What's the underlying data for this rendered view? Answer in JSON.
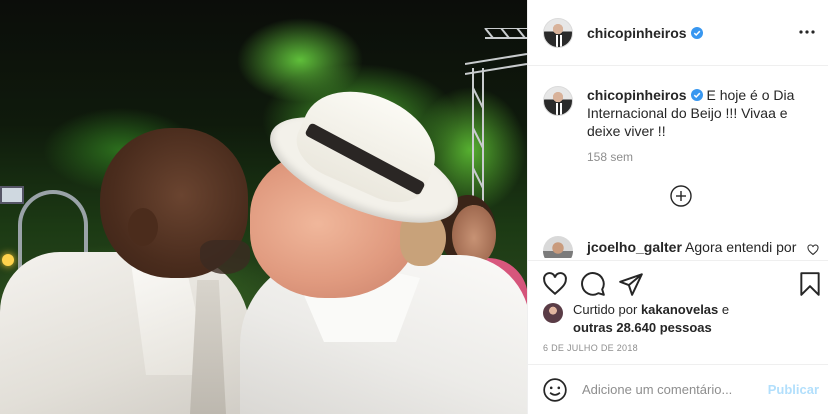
{
  "post": {
    "username": "chicopinheiros",
    "caption": "E hoje é o Dia Internacional do Beijo !!! Vivaa e deixe viver !!",
    "time_ago": "158 sem",
    "comment_preview": {
      "username": "jcoelho_galter",
      "text": "Agora entendi por"
    },
    "likes": {
      "prefix": "Curtido por",
      "user": "kakanovelas",
      "connector": "e",
      "others": "outras 28.640 pessoas"
    },
    "date": "6 DE JULHO DE 2018"
  },
  "comment_box": {
    "placeholder": "Adicione um comentário...",
    "post_label": "Publicar"
  },
  "icons": {
    "verified": "verified-badge-icon",
    "more": "more-options-icon",
    "load_more": "plus-circle-icon",
    "like": "heart-icon",
    "comment": "comment-icon",
    "share": "paper-plane-icon",
    "save": "bookmark-icon",
    "emoji": "emoji-icon"
  },
  "colors": {
    "verified_blue": "#3897f0",
    "text": "#262626",
    "muted": "#8e8e8e",
    "post_disabled": "#b2dffc"
  }
}
